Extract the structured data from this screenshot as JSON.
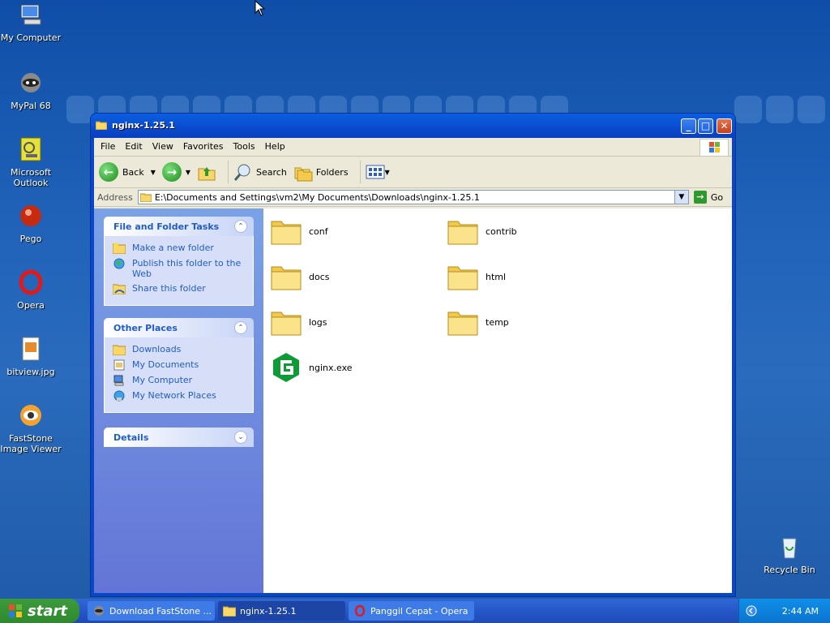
{
  "desktop": {
    "icons": [
      {
        "label": "My Computer"
      },
      {
        "label": "MyPal 68"
      },
      {
        "label": "Microsoft Outlook"
      },
      {
        "label": "Pego"
      },
      {
        "label": "Opera"
      },
      {
        "label": "bitview.jpg"
      },
      {
        "label": "FastStone Image Viewer"
      },
      {
        "label": "Recycle Bin"
      }
    ]
  },
  "window": {
    "title": "nginx-1.25.1",
    "menu": [
      "File",
      "Edit",
      "View",
      "Favorites",
      "Tools",
      "Help"
    ],
    "toolbar": {
      "back": "Back",
      "search": "Search",
      "folders": "Folders"
    },
    "address": {
      "label": "Address",
      "value": "E:\\Documents and Settings\\vm2\\My Documents\\Downloads\\nginx-1.25.1",
      "go": "Go"
    },
    "tasks_panel": {
      "title": "File and Folder Tasks",
      "items": [
        "Make a new folder",
        "Publish this folder to the Web",
        "Share this folder"
      ]
    },
    "places_panel": {
      "title": "Other Places",
      "items": [
        "Downloads",
        "My Documents",
        "My Computer",
        "My Network Places"
      ]
    },
    "details_panel": {
      "title": "Details"
    },
    "files": [
      {
        "name": "conf",
        "type": "folder"
      },
      {
        "name": "contrib",
        "type": "folder"
      },
      {
        "name": "docs",
        "type": "folder"
      },
      {
        "name": "html",
        "type": "folder"
      },
      {
        "name": "logs",
        "type": "folder"
      },
      {
        "name": "temp",
        "type": "folder"
      },
      {
        "name": "nginx.exe",
        "type": "exe"
      }
    ]
  },
  "taskbar": {
    "start": "start",
    "tasks": [
      {
        "label": "Download FastStone ..."
      },
      {
        "label": "nginx-1.25.1"
      },
      {
        "label": "Panggil Cepat - Opera"
      }
    ],
    "clock": "2:44 AM"
  },
  "colors": {
    "desktop": "#1f62b8",
    "title_bar": "#0a4ed1",
    "task_link": "#215dc6"
  }
}
